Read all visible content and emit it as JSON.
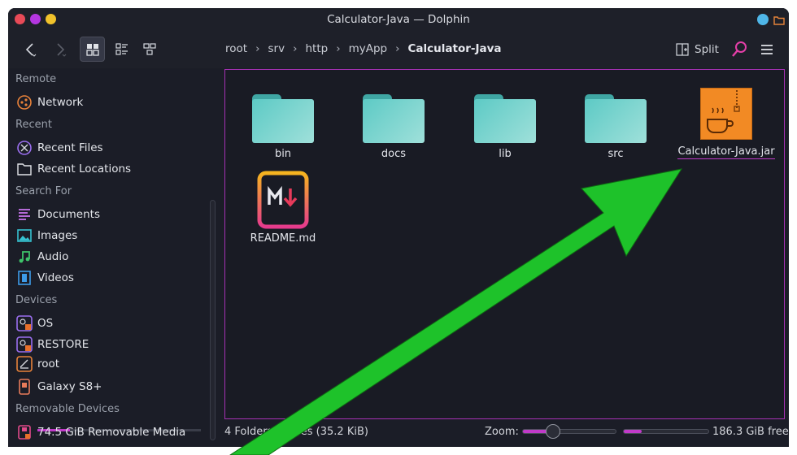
{
  "window": {
    "title": "Calculator-Java — Dolphin"
  },
  "toolbar": {
    "split_label": "Split"
  },
  "breadcrumb": [
    "root",
    "srv",
    "http",
    "myApp",
    "Calculator-Java"
  ],
  "sidebar": {
    "sections": {
      "remote": "Remote",
      "recent": "Recent",
      "search": "Search For",
      "devices": "Devices",
      "removable": "Removable Devices"
    },
    "items": {
      "network": "Network",
      "recent_files": "Recent Files",
      "recent_locations": "Recent Locations",
      "documents": "Documents",
      "images": "Images",
      "audio": "Audio",
      "videos": "Videos",
      "os": "OS",
      "restore": "RESTORE",
      "root": "root",
      "galaxy": "Galaxy S8+",
      "removable_media": "74.5 GiB Removable Media"
    },
    "root_usage_fraction": 0.2
  },
  "files": {
    "bin": "bin",
    "docs": "docs",
    "lib": "lib",
    "src": "src",
    "jar": "Calculator-Java.jar",
    "readme": "README.md"
  },
  "status": {
    "summary": "4 Folders, 2 Files (35.2 KiB)",
    "zoom_label": "Zoom:",
    "free": "186.3 GiB free"
  },
  "colors": {
    "accent": "#c13ac9",
    "folder": "#5dcac5",
    "jar": "#f28a24",
    "annotation_arrow": "#1ec22a"
  }
}
